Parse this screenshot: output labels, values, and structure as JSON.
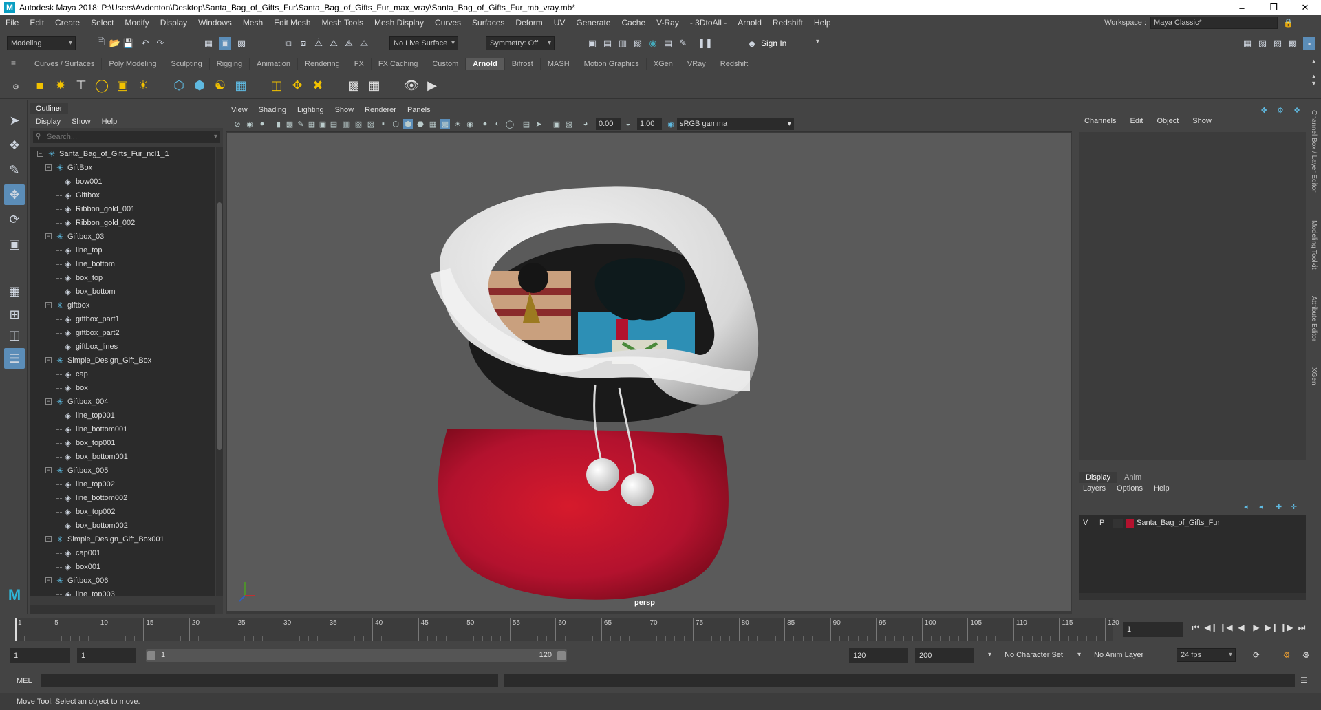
{
  "window": {
    "title": "Autodesk Maya 2018: P:\\Users\\Avdenton\\Desktop\\Santa_Bag_of_Gifts_Fur\\Santa_Bag_of_Gifts_Fur_max_vray\\Santa_Bag_of_Gifts_Fur_mb_vray.mb*",
    "minimize": "–",
    "maximize": "❐",
    "close": "✕"
  },
  "menubar": {
    "items": [
      "File",
      "Edit",
      "Create",
      "Select",
      "Modify",
      "Display",
      "Windows",
      "Mesh",
      "Edit Mesh",
      "Mesh Tools",
      "Mesh Display",
      "Curves",
      "Surfaces",
      "Deform",
      "UV",
      "Generate",
      "Cache",
      "V-Ray",
      "- 3DtoAll -",
      "Arnold",
      "Redshift",
      "Help"
    ],
    "workspace_label": "Workspace :",
    "workspace_value": "Maya Classic*"
  },
  "statusline": {
    "mode": "Modeling",
    "live_surface": "No Live Surface",
    "symmetry": "Symmetry: Off",
    "sign_in": "Sign In"
  },
  "shelf": {
    "tabs": [
      "Curves / Surfaces",
      "Poly Modeling",
      "Sculpting",
      "Rigging",
      "Animation",
      "Rendering",
      "FX",
      "FX Caching",
      "Custom",
      "Arnold",
      "Bifrost",
      "MASH",
      "Motion Graphics",
      "XGen",
      "VRay",
      "Redshift"
    ],
    "active_tab": "Arnold"
  },
  "outliner": {
    "tab": "Outliner",
    "menu": [
      "Display",
      "Show",
      "Help"
    ],
    "search_placeholder": "Search...",
    "rows": [
      {
        "label": "Santa_Bag_of_Gifts_Fur_ncl1_1",
        "depth": 0,
        "type": "group",
        "expander": "−"
      },
      {
        "label": "GiftBox",
        "depth": 1,
        "type": "group",
        "expander": "−"
      },
      {
        "label": "bow001",
        "depth": 2,
        "type": "mesh"
      },
      {
        "label": "Giftbox",
        "depth": 2,
        "type": "mesh"
      },
      {
        "label": "Ribbon_gold_001",
        "depth": 2,
        "type": "mesh"
      },
      {
        "label": "Ribbon_gold_002",
        "depth": 2,
        "type": "mesh"
      },
      {
        "label": "Giftbox_03",
        "depth": 1,
        "type": "group",
        "expander": "−"
      },
      {
        "label": "line_top",
        "depth": 2,
        "type": "mesh"
      },
      {
        "label": "line_bottom",
        "depth": 2,
        "type": "mesh"
      },
      {
        "label": "box_top",
        "depth": 2,
        "type": "mesh"
      },
      {
        "label": "box_bottom",
        "depth": 2,
        "type": "mesh"
      },
      {
        "label": "giftbox",
        "depth": 1,
        "type": "group",
        "expander": "−"
      },
      {
        "label": "giftbox_part1",
        "depth": 2,
        "type": "mesh"
      },
      {
        "label": "giftbox_part2",
        "depth": 2,
        "type": "mesh"
      },
      {
        "label": "giftbox_lines",
        "depth": 2,
        "type": "mesh"
      },
      {
        "label": "Simple_Design_Gift_Box",
        "depth": 1,
        "type": "group",
        "expander": "−"
      },
      {
        "label": "cap",
        "depth": 2,
        "type": "mesh"
      },
      {
        "label": "box",
        "depth": 2,
        "type": "mesh"
      },
      {
        "label": "Giftbox_004",
        "depth": 1,
        "type": "group",
        "expander": "−"
      },
      {
        "label": "line_top001",
        "depth": 2,
        "type": "mesh"
      },
      {
        "label": "line_bottom001",
        "depth": 2,
        "type": "mesh"
      },
      {
        "label": "box_top001",
        "depth": 2,
        "type": "mesh"
      },
      {
        "label": "box_bottom001",
        "depth": 2,
        "type": "mesh"
      },
      {
        "label": "Giftbox_005",
        "depth": 1,
        "type": "group",
        "expander": "−"
      },
      {
        "label": "line_top002",
        "depth": 2,
        "type": "mesh"
      },
      {
        "label": "line_bottom002",
        "depth": 2,
        "type": "mesh"
      },
      {
        "label": "box_top002",
        "depth": 2,
        "type": "mesh"
      },
      {
        "label": "box_bottom002",
        "depth": 2,
        "type": "mesh"
      },
      {
        "label": "Simple_Design_Gift_Box001",
        "depth": 1,
        "type": "group",
        "expander": "−"
      },
      {
        "label": "cap001",
        "depth": 2,
        "type": "mesh"
      },
      {
        "label": "box001",
        "depth": 2,
        "type": "mesh"
      },
      {
        "label": "Giftbox_006",
        "depth": 1,
        "type": "group",
        "expander": "−"
      },
      {
        "label": "line_top003",
        "depth": 2,
        "type": "mesh"
      }
    ]
  },
  "viewport": {
    "menu": [
      "View",
      "Shading",
      "Lighting",
      "Show",
      "Renderer",
      "Panels"
    ],
    "near_value": "0.00",
    "gamma_value": "1.00",
    "color_space": "sRGB gamma",
    "camera_label": "persp"
  },
  "channelbox": {
    "menu": [
      "Channels",
      "Edit",
      "Object",
      "Show"
    ],
    "layer_tabs": [
      "Display",
      "Anim"
    ],
    "layer_menu": [
      "Layers",
      "Options",
      "Help"
    ],
    "layer": {
      "v": "V",
      "p": "P",
      "name": "Santa_Bag_of_Gifts_Fur",
      "color": "#b3122e"
    },
    "side_tabs": [
      "Channel Box / Layer Editor",
      "Modeling Toolkit",
      "Attribute Editor",
      "XGen"
    ]
  },
  "timeline": {
    "ticks": [
      "1",
      "5",
      "10",
      "15",
      "20",
      "25",
      "30",
      "35",
      "40",
      "45",
      "50",
      "55",
      "60",
      "65",
      "70",
      "75",
      "80",
      "85",
      "90",
      "95",
      "100",
      "105",
      "110",
      "115",
      "120"
    ],
    "current_frame": "1"
  },
  "range": {
    "start": "1",
    "playback_start": "1",
    "slider_start": "1",
    "slider_end": "120",
    "playback_end": "120",
    "end": "200",
    "character_set": "No Character Set",
    "anim_layer": "No Anim Layer",
    "fps": "24 fps"
  },
  "mel": {
    "label": "MEL"
  },
  "help": {
    "text": "Move Tool: Select an object to move."
  },
  "colors": {
    "accent": "#5b8db8",
    "bag_red": "#b3122e",
    "fur_white": "#e8e8e8"
  }
}
